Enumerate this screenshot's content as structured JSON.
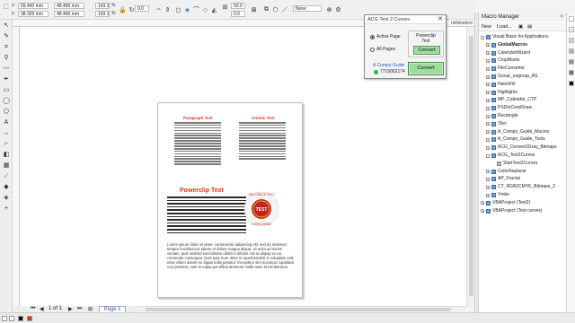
{
  "propbar": {
    "x_value": "59.442 mm",
    "y_value": "38.303 mm",
    "w_value": "48.466 mm",
    "h_value": "48.466 mm",
    "scale_x": "143.1",
    "scale_y": "143.1",
    "pct": "%",
    "angle": "0.0",
    "pos_val": "50.0",
    "pos_val2": "0.0",
    "none_select": "None",
    "units_label": "millimeters"
  },
  "dialog": {
    "title": "ACG Text 2 Curves",
    "close": "✕",
    "opt_active": "Active Page",
    "opt_all": "All Pages",
    "group_title": "Powerclip Text",
    "convert_small": "Convert",
    "convert_big": "Convert",
    "link": "A Compo Guide",
    "phone": "7715062174"
  },
  "macro_manager": {
    "title": "Macro Manager",
    "close": "×",
    "toolbar": [
      "New",
      "Load...",
      "▣",
      "▤"
    ],
    "tree": [
      {
        "label": "Visual Basic for Applications",
        "indent": 0,
        "icon": "proj",
        "exp": "–"
      },
      {
        "label": "GlobalMacros",
        "indent": 1,
        "icon": "proj",
        "exp": "+",
        "bold": true
      },
      {
        "label": "CalendarWizard",
        "indent": 1,
        "icon": "proj",
        "exp": "+"
      },
      {
        "label": "CropMarks",
        "indent": 1,
        "icon": "proj",
        "exp": "+"
      },
      {
        "label": "FileConverter",
        "indent": 1,
        "icon": "proj",
        "exp": "+"
      },
      {
        "label": "Group_ungroup_AS",
        "indent": 1,
        "icon": "proj",
        "exp": "+"
      },
      {
        "label": "HatchFill",
        "indent": 1,
        "icon": "proj",
        "exp": "+"
      },
      {
        "label": "Highlights",
        "indent": 1,
        "icon": "proj",
        "exp": "+"
      },
      {
        "label": "MP_Calendar_CTP",
        "indent": 1,
        "icon": "proj",
        "exp": "+"
      },
      {
        "label": "PSDtoCorelDraw",
        "indent": 1,
        "icon": "proj",
        "exp": "+"
      },
      {
        "label": "Rectangle",
        "indent": 1,
        "icon": "proj",
        "exp": "+"
      },
      {
        "label": "Tiler",
        "indent": 1,
        "icon": "proj",
        "exp": "+"
      },
      {
        "label": "A_Compo_Guide_Macros",
        "indent": 1,
        "icon": "proj",
        "exp": "+"
      },
      {
        "label": "A_Compo_Guide_Tools",
        "indent": 1,
        "icon": "proj",
        "exp": "+"
      },
      {
        "label": "ACG_Convert2Gray_Bitmaps",
        "indent": 1,
        "icon": "proj",
        "exp": "+"
      },
      {
        "label": "ACG_Text2Curves",
        "indent": 1,
        "icon": "proj",
        "exp": "–"
      },
      {
        "label": "StartText2Curves",
        "indent": 2,
        "icon": "mac",
        "exp": ""
      },
      {
        "label": "ColorReplacer",
        "indent": 1,
        "icon": "proj",
        "exp": "+"
      },
      {
        "label": "AP_Fractal",
        "indent": 1,
        "icon": "proj",
        "exp": "+"
      },
      {
        "label": "CT_RGB2CMYK_Bitmaps_3",
        "indent": 1,
        "icon": "proj",
        "exp": "+"
      },
      {
        "label": "Ymke",
        "indent": 1,
        "icon": "proj",
        "exp": "+"
      },
      {
        "label": "VBAProject (Test2)",
        "indent": 0,
        "icon": "proj",
        "exp": "+"
      },
      {
        "label": "VBAProject (Text curves)",
        "indent": 0,
        "icon": "proj",
        "exp": "+"
      }
    ]
  },
  "document": {
    "col1_heading": "Paragraph Text",
    "col2_heading": "Artistic Text",
    "powerclip_heading": "Powerclip Text",
    "badge_top": "RED CIRCLE TEXT",
    "badge_center": "TEST",
    "badge_bottom": "COREL DRAW",
    "body_text": "Lorem ipsum dolor sit amet, consectetur adipiscing elit, sed do eiusmod tempor incididunt ut labore et dolore magna aliqua. Ut enim ad minim veniam, quis nostrud exercitation ullamco laboris nisi ut aliquip ex ea commodo consequat. Duis aute irure dolor in reprehenderit in voluptate velit esse cillum dolore eu fugiat nulla pariatur. Excepteur sint occaecat cupidatat non proident, sunt in culpa qui officia deserunt mollit anim id est laborum."
  },
  "bottom": {
    "page_nav": "1 of 1",
    "page_tab": "Page 1"
  },
  "colors": {
    "accent_red": "#d43a1a",
    "convert_green": "#9fdc9f",
    "link_blue": "#2057c9"
  }
}
